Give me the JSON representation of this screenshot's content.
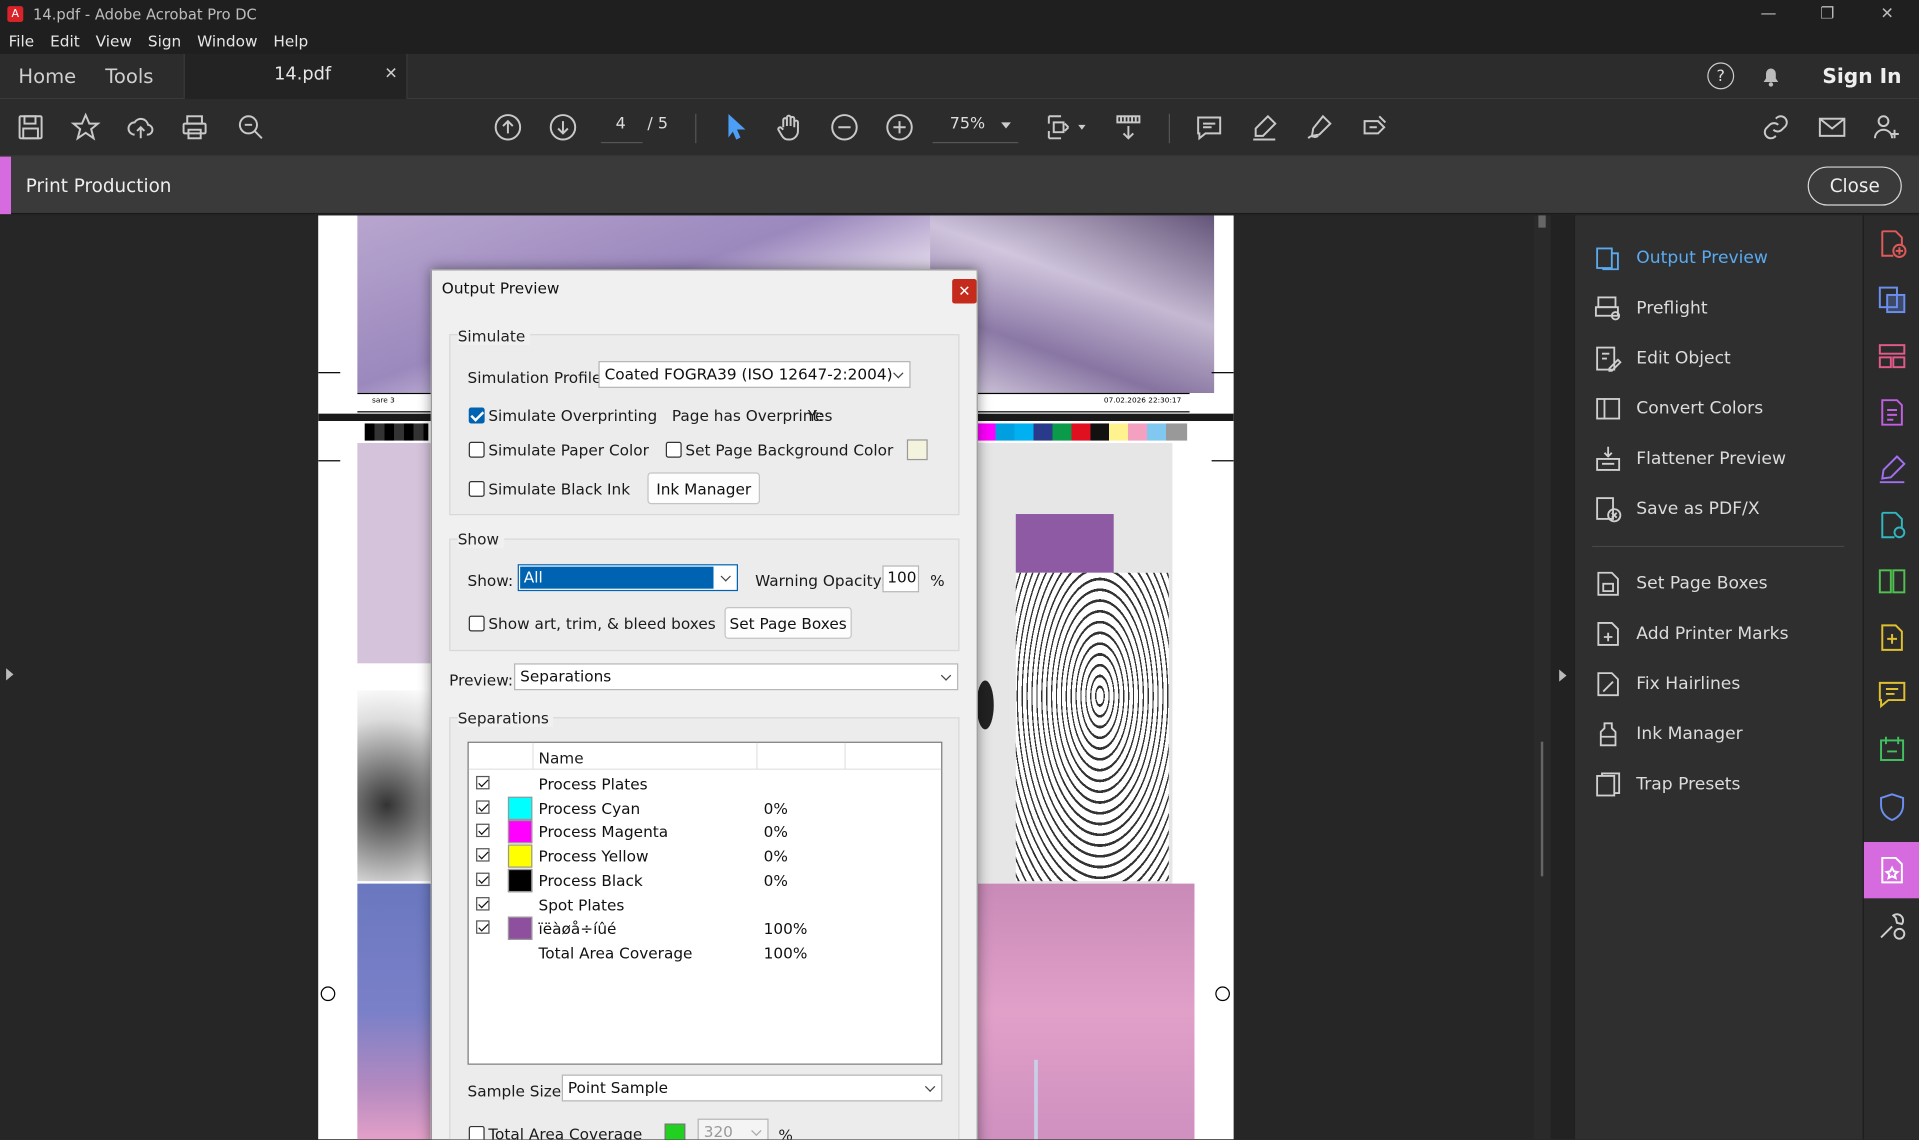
{
  "window": {
    "title": "14.pdf - Adobe Acrobat Pro DC"
  },
  "menu": [
    "File",
    "Edit",
    "View",
    "Sign",
    "Window",
    "Help"
  ],
  "tabs": {
    "home": "Home",
    "tools": "Tools",
    "document": "14.pdf"
  },
  "header": {
    "sign_in": "Sign In"
  },
  "toolbar": {
    "current_page": "4",
    "total_pages": "/ 5",
    "zoom": "75%"
  },
  "print_production": {
    "label": "Print Production",
    "close": "Close"
  },
  "right_panel": {
    "items": [
      "Output Preview",
      "Preflight",
      "Edit Object",
      "Convert Colors",
      "Flattener Preview",
      "Save as PDF/X"
    ],
    "items2": [
      "Set Page Boxes",
      "Add Printer Marks",
      "Fix Hairlines",
      "Ink Manager",
      "Trap Presets"
    ]
  },
  "page_marks": {
    "left_slug": "sare 3",
    "right_slug": "07.02.2026  22:30:17"
  },
  "dialog": {
    "title": "Output Preview",
    "simulate": {
      "group": "Simulate",
      "profile_label": "Simulation Profile:",
      "profile_value": "Coated FOGRA39 (ISO 12647-2:2004)",
      "overprinting": "Simulate Overprinting",
      "page_overprint_label": "Page has Overprint:",
      "page_overprint_value": "Yes",
      "paper_color": "Simulate Paper Color",
      "page_bg": "Set Page Background Color",
      "black_ink": "Simulate Black Ink",
      "ink_manager": "Ink Manager"
    },
    "show": {
      "group": "Show",
      "show_label": "Show:",
      "show_value": "All",
      "warning_label": "Warning Opacity:",
      "warning_value": "100",
      "percent": "%",
      "boxes": "Show art, trim, & bleed boxes",
      "set_page_boxes": "Set Page Boxes"
    },
    "preview": {
      "label": "Preview:",
      "value": "Separations"
    },
    "separations": {
      "group": "Separations",
      "name_header": "Name",
      "rows": [
        {
          "name": "Process Plates",
          "value": "",
          "color": "",
          "checked": true
        },
        {
          "name": "Process Cyan",
          "value": "0%",
          "color": "#00ffff",
          "checked": true
        },
        {
          "name": "Process Magenta",
          "value": "0%",
          "color": "#ff00ff",
          "checked": true
        },
        {
          "name": "Process Yellow",
          "value": "0%",
          "color": "#ffff00",
          "checked": true
        },
        {
          "name": "Process Black",
          "value": "0%",
          "color": "#000000",
          "checked": true
        },
        {
          "name": "Spot Plates",
          "value": "",
          "color": "",
          "checked": true
        },
        {
          "name": "ïëàøå÷íûé",
          "value": "100%",
          "color": "#8e4f9e",
          "checked": true
        },
        {
          "name": "Total Area Coverage",
          "value": "100%",
          "color": "",
          "checked": false
        }
      ]
    },
    "sample": {
      "label": "Sample Size:",
      "value": "Point Sample"
    },
    "tac": {
      "label": "Total Area Coverage",
      "value": "320",
      "percent": "%"
    }
  }
}
